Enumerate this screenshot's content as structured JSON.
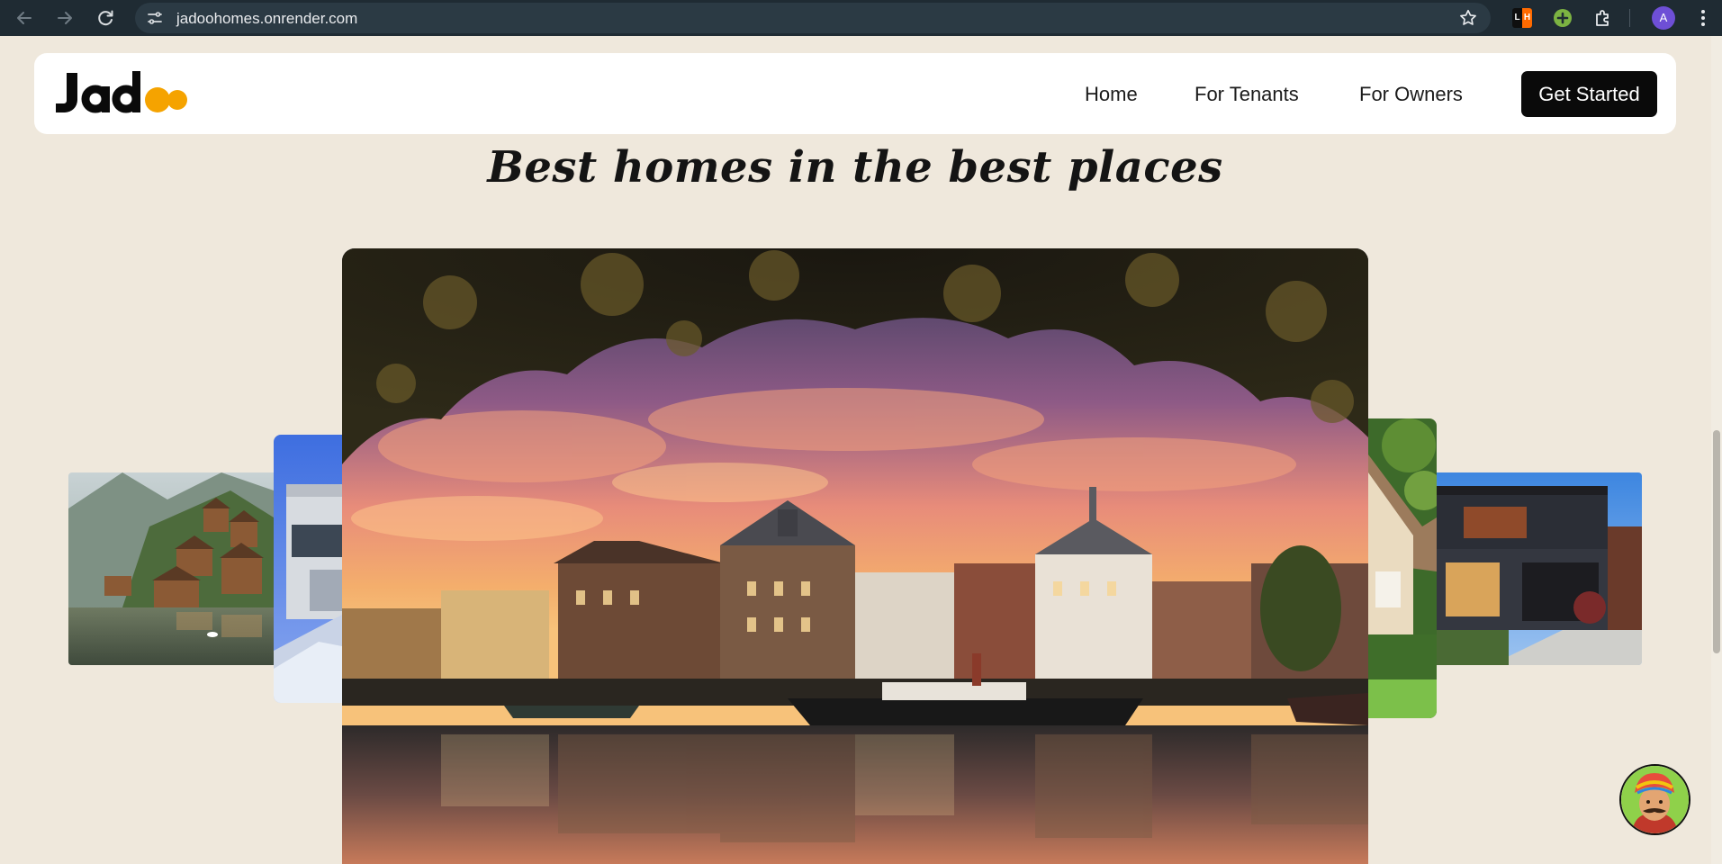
{
  "browser": {
    "url": "jadoohomes.onrender.com",
    "back_icon": "arrow-left-icon",
    "forward_icon": "arrow-right-icon",
    "reload_icon": "reload-icon",
    "site_info_icon": "tune-icon",
    "bookmark_icon": "star-icon",
    "extensions": [
      {
        "name": "lighthouse-extension-icon",
        "label_left": "L",
        "label_right": "H"
      },
      {
        "name": "add-extension-icon"
      },
      {
        "name": "puzzle-piece-icon"
      }
    ],
    "profile_initial": "A",
    "menu_icon": "kebab-menu-icon"
  },
  "header": {
    "logo_text": "Jadoo",
    "nav": [
      {
        "label": "Home"
      },
      {
        "label": "For Tenants"
      },
      {
        "label": "For Owners"
      }
    ],
    "cta_label": "Get Started"
  },
  "hero": {
    "headline": "Best homes in the best places"
  },
  "carousel": {
    "slides": [
      {
        "name": "mountain-lake-village-image"
      },
      {
        "name": "modern-blue-building-image"
      },
      {
        "name": "canal-town-sunset-image"
      },
      {
        "name": "green-garden-house-image"
      },
      {
        "name": "modern-house-garage-image"
      }
    ]
  },
  "chat_widget": {
    "icon": "turban-man-avatar-icon"
  },
  "colors": {
    "page_bg": "#efe8dc",
    "header_bg": "#ffffff",
    "cta_bg": "#0a0a0a",
    "logo_accent": "#f5a300"
  }
}
